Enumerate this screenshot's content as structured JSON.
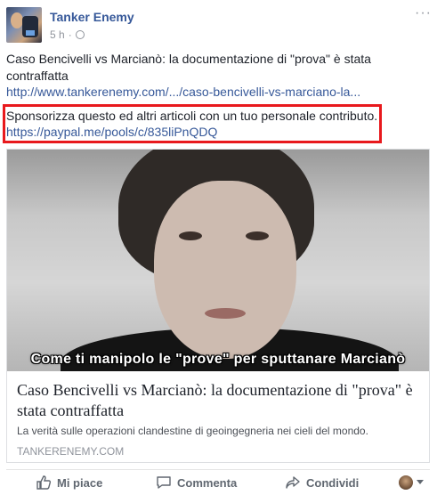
{
  "post": {
    "author": "Tanker Enemy",
    "time": "5 h",
    "separator": "·",
    "more_icon": "···",
    "text1": "Caso Bencivelli vs Marcianò: la documentazione di \"prova\" è stata contraffatta",
    "link1": "http://www.tankerenemy.com/.../caso-bencivelli-vs-marciano-la...",
    "text2": "Sponsorizza questo ed altri articoli con un tuo personale contributo.",
    "link2": "https://paypal.me/pools/c/835liPnQDQ"
  },
  "card": {
    "image_caption": "Come ti manipolo le \"prove\" per sputtanare Marcianò",
    "title": "Caso Bencivelli vs Marcianò: la documentazione di \"prova\" è stata contraffatta",
    "description": "La verità sulle operazioni clandestine di geoingegneria nei cieli del mondo.",
    "domain": "TANKERENEMY.COM"
  },
  "actions": {
    "like": "Mi piace",
    "comment": "Commenta",
    "share": "Condividi"
  },
  "colors": {
    "link": "#365899",
    "highlight_border": "#e8191d",
    "muted": "#90949c"
  },
  "icons": {
    "privacy": "globe-icon",
    "like": "thumbs-up-icon",
    "comment": "speech-bubble-icon",
    "share": "share-arrow-icon"
  }
}
